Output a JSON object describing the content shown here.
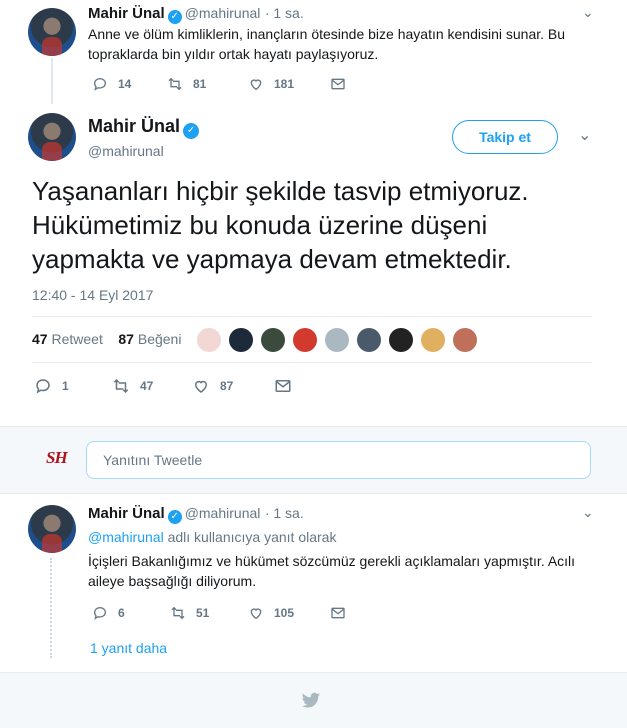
{
  "tweet1": {
    "name": "Mahir Ünal",
    "handle": "@mahirunal",
    "time": "· 1 sa.",
    "text_line1": "Anne ve ölüm kimliklerin, inançların ötesinde bize hayatın kendisini sunar. Bu",
    "text_line2": "topraklarda bin yıldır ortak hayatı paylaşıyoruz.",
    "replies": "14",
    "retweets": "81",
    "likes": "181"
  },
  "main": {
    "name": "Mahir Ünal",
    "handle": "@mahirunal",
    "follow_label": "Takip et",
    "text_line1": "Yaşananları hiçbir şekilde tasvip etmiyoruz.",
    "text_line2": "Hükümetimiz bu konuda üzerine düşeni",
    "text_line3": "yapmakta ve yapmaya devam etmektedir.",
    "timestamp": "12:40 - 14 Eyl 2017",
    "retweet_count": "47",
    "retweet_label": "Retweet",
    "like_count": "87",
    "like_label": "Beğeni",
    "replies": "1",
    "retweets": "47",
    "likes": "87"
  },
  "reply_box": {
    "logo_text": "SH",
    "placeholder": "Yanıtını Tweetle"
  },
  "tweet3": {
    "name": "Mahir Ünal",
    "handle": "@mahirunal",
    "time": "· 1 sa.",
    "reply_to_user": "@mahirunal",
    "reply_to_suffix": " adlı kullanıcıya yanıt olarak",
    "text_line1": "İçişleri Bakanlığımız ve hükümet sözcümüz gerekli açıklamaları yapmıştır. Acılı",
    "text_line2": "aileye başsağlığı diliyorum.",
    "replies": "6",
    "retweets": "51",
    "likes": "105",
    "more_replies": "1 yanıt daha"
  },
  "colors": {
    "accent": "#1da1f2",
    "muted": "#657786",
    "divider": "#e6ecf0"
  }
}
